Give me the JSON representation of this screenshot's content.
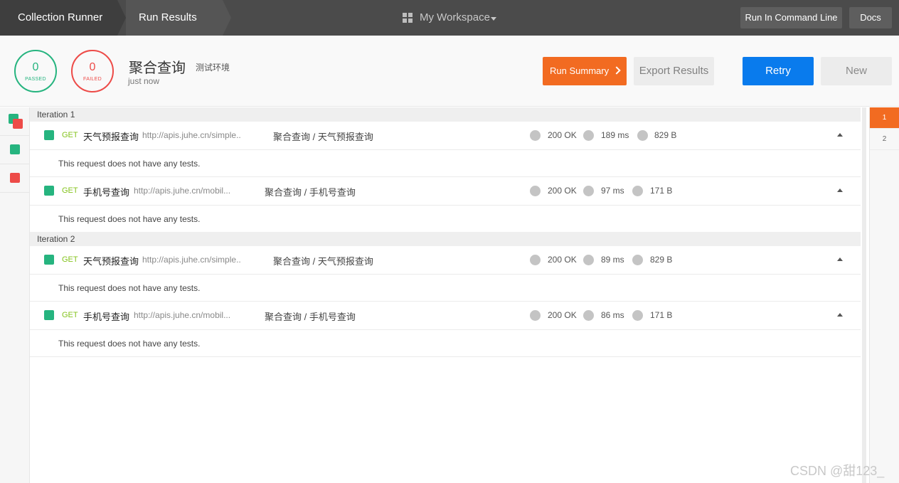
{
  "topbar": {
    "crumb1": "Collection Runner",
    "crumb2": "Run Results",
    "workspace": "My Workspace",
    "run_cmd": "Run In Command Line",
    "docs": "Docs"
  },
  "summary": {
    "passed_count": "0",
    "passed_label": "PASSED",
    "failed_count": "0",
    "failed_label": "FAILED",
    "collection": "聚合查询",
    "environment": "测试环境",
    "time": "just now",
    "run_summary": "Run Summary",
    "export": "Export Results",
    "retry": "Retry",
    "new": "New"
  },
  "iterations": [
    {
      "label": "Iteration 1",
      "requests": [
        {
          "method": "GET",
          "name": "天气预报查询",
          "url": "http://apis.juhe.cn/simple..",
          "path": "聚合查询 / 天气预报查询",
          "status": "200 OK",
          "time": "189 ms",
          "size": "829 B",
          "note": "This request does not have any tests."
        },
        {
          "method": "GET",
          "name": "手机号查询",
          "url": "http://apis.juhe.cn/mobil...",
          "path": "聚合查询 / 手机号查询",
          "status": "200 OK",
          "time": "97 ms",
          "size": "171 B",
          "note": "This request does not have any tests."
        }
      ]
    },
    {
      "label": "Iteration 2",
      "requests": [
        {
          "method": "GET",
          "name": "天气预报查询",
          "url": "http://apis.juhe.cn/simple..",
          "path": "聚合查询 / 天气预报查询",
          "status": "200 OK",
          "time": "89 ms",
          "size": "829 B",
          "note": "This request does not have any tests."
        },
        {
          "method": "GET",
          "name": "手机号查询",
          "url": "http://apis.juhe.cn/mobil...",
          "path": "聚合查询 / 手机号查询",
          "status": "200 OK",
          "time": "86 ms",
          "size": "171 B",
          "note": "This request does not have any tests."
        }
      ]
    }
  ],
  "iteration_nav": [
    "1",
    "2"
  ],
  "watermark": "CSDN @甜123_",
  "colors": {
    "pass": "#26b47f",
    "fail": "#ed4b48",
    "accent": "#f26b21",
    "primary": "#097bed",
    "method": "#84c31d"
  }
}
